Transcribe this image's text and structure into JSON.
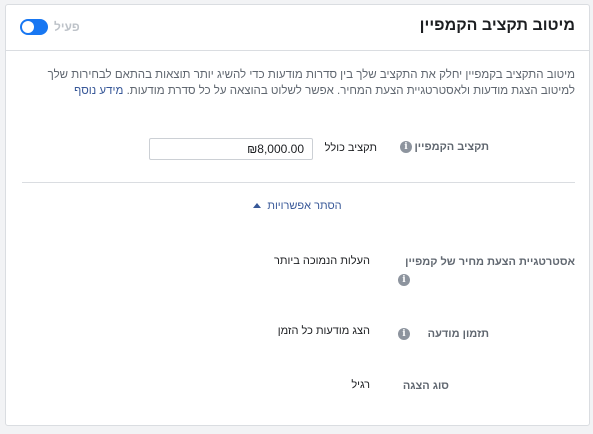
{
  "header": {
    "title": "מיטוב תקציב הקמפיין",
    "toggle_label": "פעיל"
  },
  "description": {
    "text": "מיטוב התקציב בקמפיין יחלק את התקציב שלך בין סדרות מודעות כדי להשיג יותר תוצאות בהתאם לבחירות שלך למיטוב הצגת מודעות ולאסטרטגיית הצעת המחיר. אפשר לשלוט בהוצאה על כל סדרת מודעות.",
    "link": "מידע נוסף"
  },
  "budget": {
    "label": "תקציב הקמפיין",
    "type_label": "תקציב כולל",
    "value": "₪8,000.00"
  },
  "options_toggle": {
    "label": "הסתר אפשרויות"
  },
  "bid_strategy": {
    "label": "אסטרטגיית הצעת מחיר של קמפיין",
    "value": "העלות הנמוכה ביותר"
  },
  "ad_scheduling": {
    "label": "תזמון מודעה",
    "value": "הצג מודעות כל הזמן"
  },
  "delivery_type": {
    "label": "סוג הצגה",
    "value": "רגיל"
  },
  "icons": {
    "info": "info-icon",
    "caret": "caret-up-icon"
  },
  "colors": {
    "accent": "#1877f2",
    "link": "#385898",
    "label": "#606770"
  }
}
